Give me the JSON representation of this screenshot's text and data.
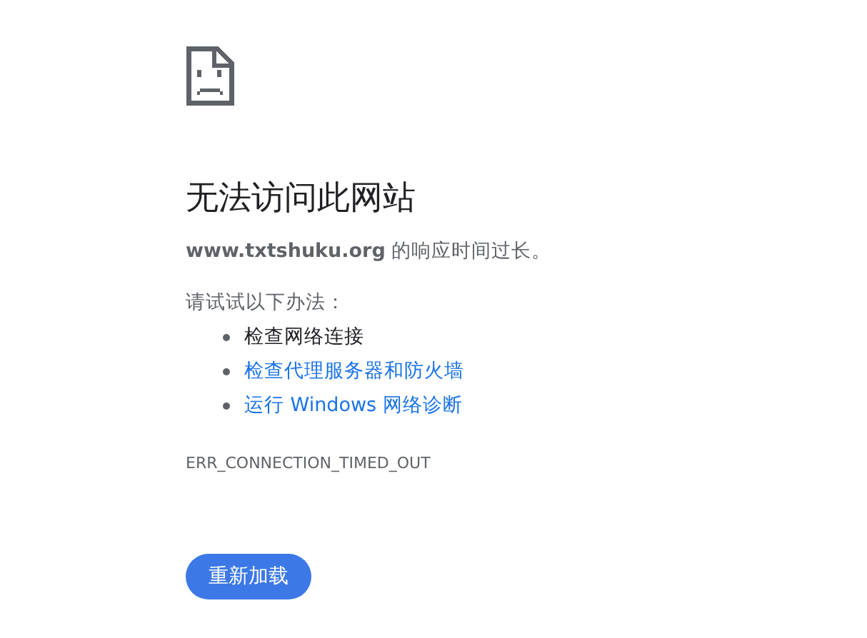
{
  "heading": "无法访问此网站",
  "message": "**www.txtshuku.org** 的响应时间过长。",
  "suggestions_title": "请试试以下办法：",
  "suggestions": [
    {
      "kind": "text",
      "label": "检查网络连接"
    },
    {
      "kind": "link",
      "label": "检查代理服务器和防火墙"
    },
    {
      "kind": "link",
      "label": "运行 Windows 网络诊断"
    }
  ],
  "error_code": "ERR_CONNECTION_TIMED_OUT",
  "reload_button": "重新加载"
}
